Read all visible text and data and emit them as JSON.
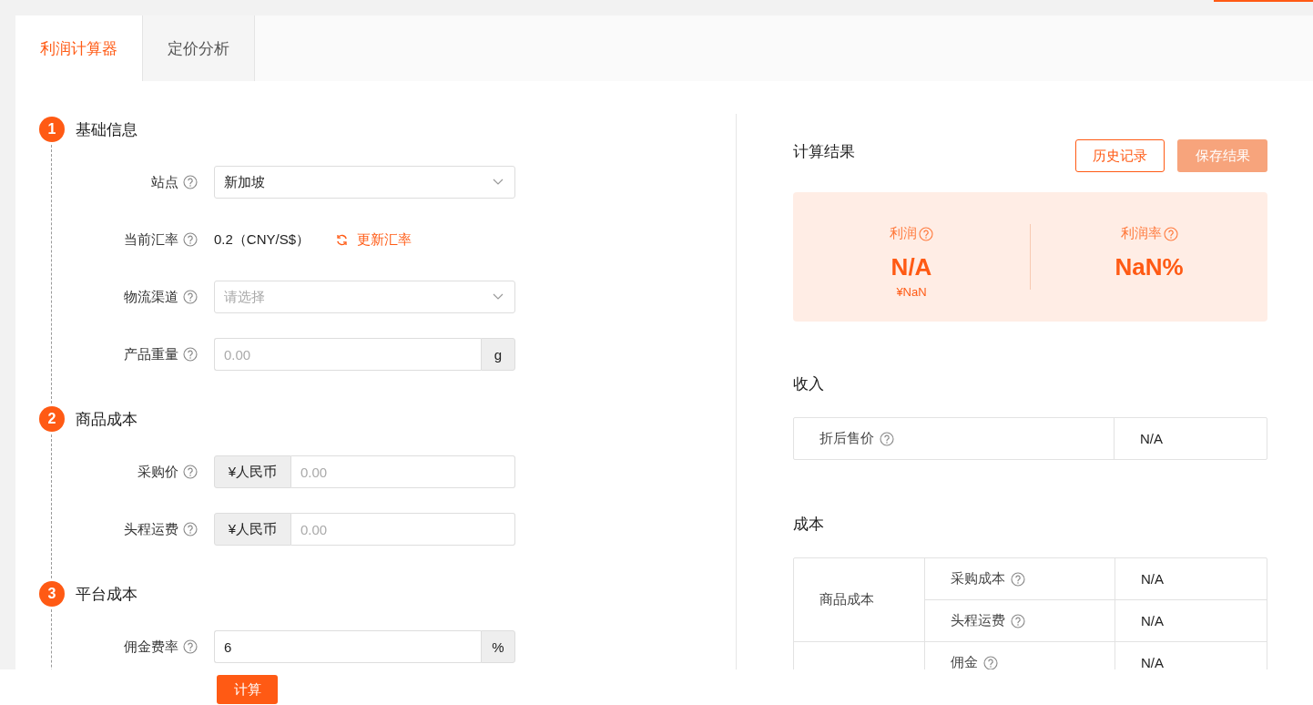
{
  "tabs": [
    {
      "label": "利润计算器",
      "selected": true
    },
    {
      "label": "定价分析",
      "selected": false
    }
  ],
  "sections": [
    {
      "number": "1",
      "title": "基础信息",
      "fields": [
        {
          "kind": "select",
          "label": "站点",
          "value": "新加坡"
        },
        {
          "kind": "rate",
          "label": "当前汇率",
          "value": "0.2（CNY/S$）",
          "action": "更新汇率"
        },
        {
          "kind": "select",
          "label": "物流渠道",
          "placeholder": "请选择"
        },
        {
          "kind": "suffix",
          "label": "产品重量",
          "placeholder": "0.00",
          "addon": "g"
        }
      ]
    },
    {
      "number": "2",
      "title": "商品成本",
      "fields": [
        {
          "kind": "prefix",
          "label": "采购价",
          "placeholder": "0.00",
          "addon": "¥人民币"
        },
        {
          "kind": "prefix",
          "label": "头程运费",
          "placeholder": "0.00",
          "addon": "¥人民币"
        }
      ]
    },
    {
      "number": "3",
      "title": "平台成本",
      "fields": [
        {
          "kind": "suffix",
          "label": "佣金费率",
          "value": "6",
          "addon": "%"
        }
      ]
    }
  ],
  "calculate_button": "计算",
  "results": {
    "title": "计算结果",
    "history_button": "历史记录",
    "save_button": {
      "label": "保存结果",
      "disabled": true
    },
    "metrics": [
      {
        "label": "利润",
        "value": "N/A",
        "sub": "¥NaN"
      },
      {
        "label": "利润率",
        "value": "NaN%"
      }
    ]
  },
  "income": {
    "title": "收入",
    "rows": [
      {
        "label": "折后售价",
        "value": "N/A"
      }
    ]
  },
  "cost": {
    "title": "成本",
    "groups": [
      {
        "label": "商品成本",
        "rows": [
          {
            "label": "采购成本",
            "value": "N/A"
          },
          {
            "label": "头程运费",
            "value": "N/A"
          }
        ]
      },
      {
        "rows": [
          {
            "label": "佣金",
            "value": "N/A"
          }
        ]
      }
    ]
  }
}
